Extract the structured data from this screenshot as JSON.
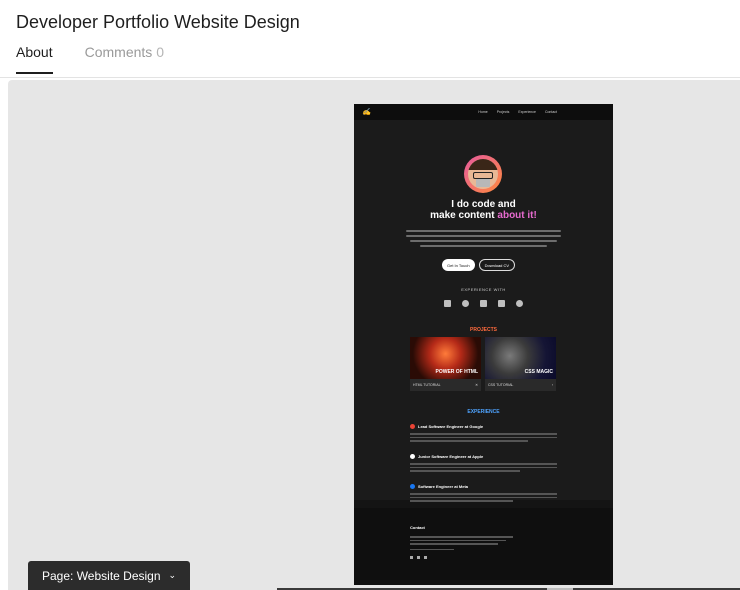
{
  "header": {
    "title": "Developer Portfolio Website Design",
    "tabs": [
      {
        "label": "About",
        "active": true
      },
      {
        "label": "Comments",
        "count": "0",
        "active": false
      }
    ]
  },
  "page_selector": {
    "label": "Page: Website Design",
    "icon": "chevron-down-icon"
  },
  "portfolio": {
    "nav_links": [
      "Home",
      "Projects",
      "Experience",
      "Contact"
    ],
    "hero_line1": "I do code and",
    "hero_line2_prefix": "make content ",
    "hero_line2_accent": "about it!",
    "btn_primary": "Get In Touch",
    "btn_secondary": "Download CV",
    "experience_with": "EXPERIENCE WITH",
    "projects_title": "PROJECTS",
    "cards": [
      {
        "tag": "POWER OF HTML",
        "foot": "HTML TUTORIAL"
      },
      {
        "tag": "CSS MAGIC",
        "foot": "CSS TUTORIAL"
      }
    ],
    "experience_title": "EXPERIENCE",
    "experiences": [
      {
        "role": "Lead Software Engineer at Google",
        "dot": "#ea4335"
      },
      {
        "role": "Junior Software Engineer at Apple",
        "dot": "#ffffff"
      },
      {
        "role": "Software Engineer at Meta",
        "dot": "#1877f2"
      }
    ],
    "contact_title": "Contact"
  }
}
